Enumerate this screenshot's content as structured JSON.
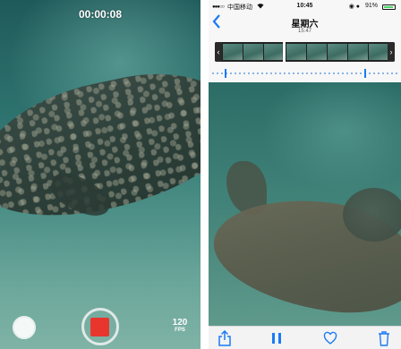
{
  "left_phone": {
    "timer": "00:00:08",
    "fps_value": "120",
    "fps_unit": "FPS",
    "icons": {
      "shutter": "shutter-circle-icon",
      "record": "record-stop-icon"
    }
  },
  "right_phone": {
    "status_bar": {
      "signal": "●●●○○",
      "carrier": "中国移动",
      "time": "10:45",
      "battery_percent": "91%"
    },
    "title": "星期六",
    "subtitle": "15:47",
    "toolbar": {
      "icons": [
        "share-icon",
        "pause-icon",
        "heart-icon",
        "trash-icon"
      ]
    }
  },
  "colors": {
    "ios_blue": "#1a7bf5",
    "record_red": "#e8362f"
  }
}
